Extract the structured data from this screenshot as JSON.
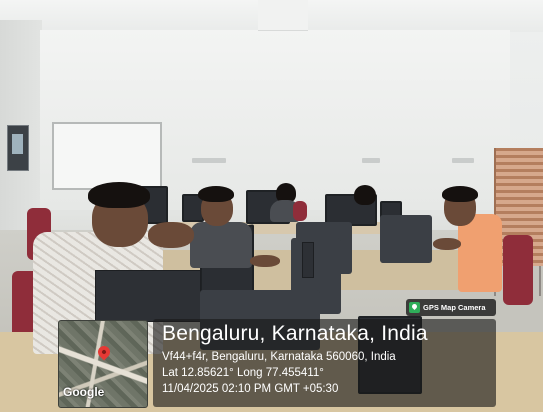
{
  "overlay": {
    "badge_label": "GPS Map Camera",
    "city": "Bengaluru, Karnataka, India",
    "address": "Vf44+f4r, Bengaluru, Karnataka 560060, India",
    "coordinates": "Lat 12.85621° Long 77.455411°",
    "datetime": "11/04/2025 02:10 PM GMT +05:30",
    "map_logo": "Google"
  },
  "colors": {
    "chair_red": "#8f2d3a",
    "gps_badge_green": "#2fae5a",
    "map_pin_red": "#e53935"
  },
  "icons": {
    "badge_icon": "gps-map-camera-icon",
    "pin_icon": "map-pin-icon"
  }
}
